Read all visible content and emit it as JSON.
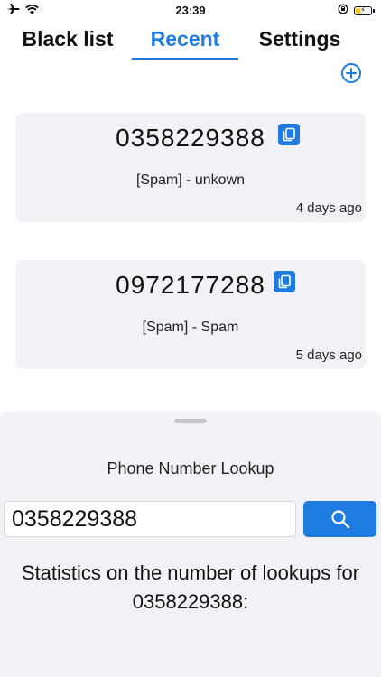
{
  "status_bar": {
    "time": "23:39",
    "icons": [
      "airplane-icon",
      "wifi-icon",
      "rotation-lock-icon",
      "battery-icon"
    ],
    "battery_level": 0.35
  },
  "tabs": [
    {
      "label": "Black list",
      "active": false
    },
    {
      "label": "Recent",
      "active": true
    },
    {
      "label": "Settings",
      "active": false
    }
  ],
  "add_icon": "plus-circle-icon",
  "recent": [
    {
      "number": "0358229388",
      "label": "[Spam] - unkown",
      "time": "4 days ago"
    },
    {
      "number": "0972177288",
      "label": "[Spam] - Spam",
      "time": "5 days ago"
    }
  ],
  "lookup": {
    "title": "Phone Number Lookup",
    "input_value": "0358229388",
    "search_icon": "search-icon",
    "stats_text": "Statistics on the number of lookups for 0358229388:"
  },
  "colors": {
    "accent": "#1e7be0",
    "card_bg": "#f2f2f6",
    "text": "#111111"
  }
}
